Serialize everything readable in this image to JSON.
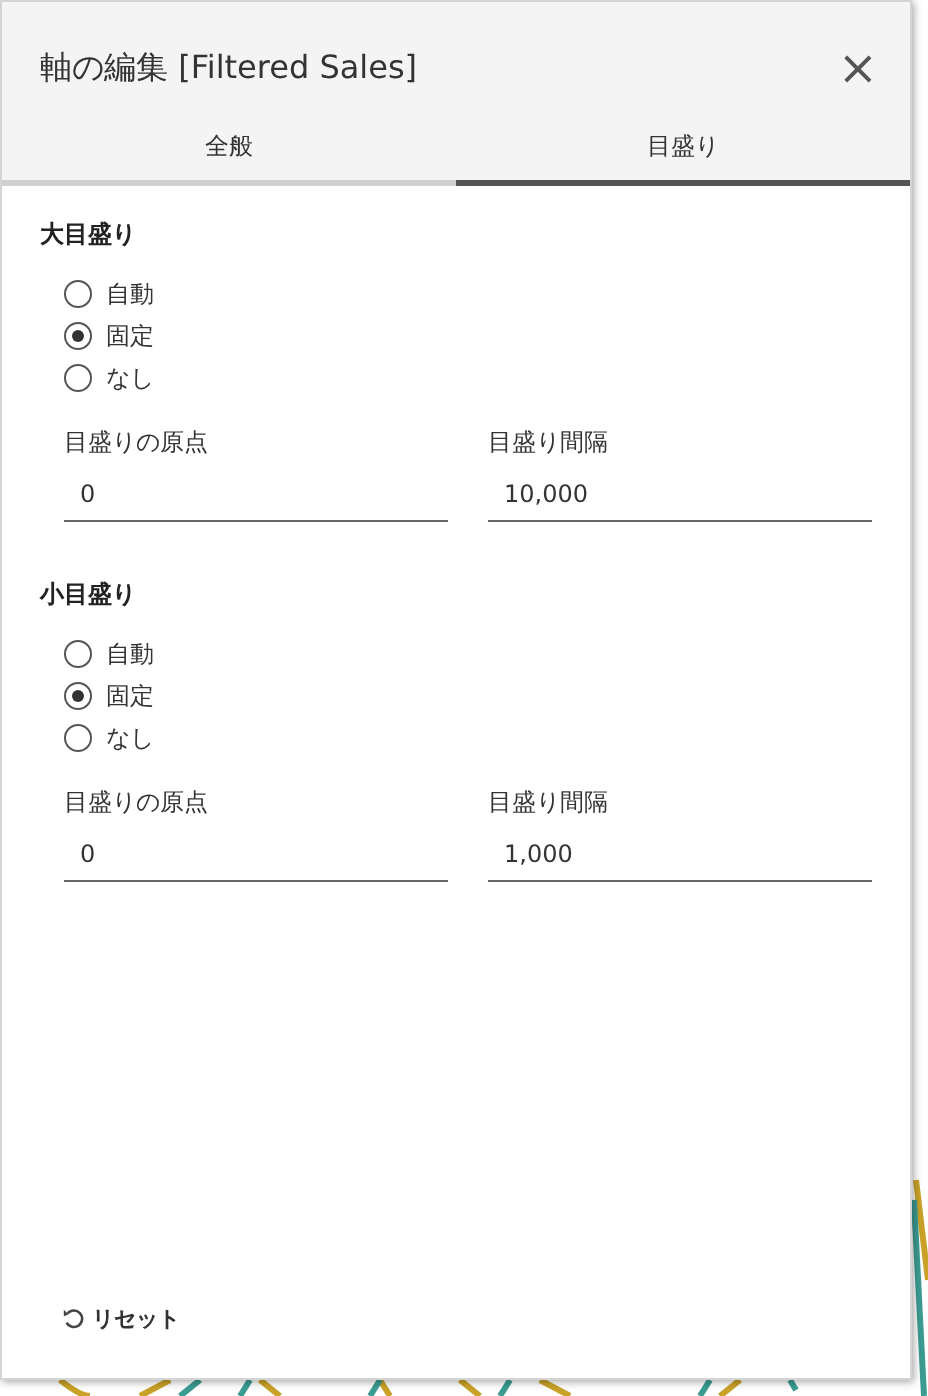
{
  "dialog": {
    "title": "軸の編集 [Filtered Sales]",
    "close": "×"
  },
  "tabs": [
    {
      "label": "全般",
      "selected": false
    },
    {
      "label": "目盛り",
      "selected": true
    }
  ],
  "sections": [
    {
      "title": "大目盛り",
      "options": [
        {
          "label": "自動",
          "selected": false
        },
        {
          "label": "固定",
          "selected": true
        },
        {
          "label": "なし",
          "selected": false
        }
      ],
      "fields": [
        {
          "label": "目盛りの原点",
          "value": "0"
        },
        {
          "label": "目盛り間隔",
          "value": "10,000"
        }
      ]
    },
    {
      "title": "小目盛り",
      "options": [
        {
          "label": "自動",
          "selected": false
        },
        {
          "label": "固定",
          "selected": true
        },
        {
          "label": "なし",
          "selected": false
        }
      ],
      "fields": [
        {
          "label": "目盛りの原点",
          "value": "0"
        },
        {
          "label": "目盛り間隔",
          "value": "1,000"
        }
      ]
    }
  ],
  "reset": "リセット"
}
